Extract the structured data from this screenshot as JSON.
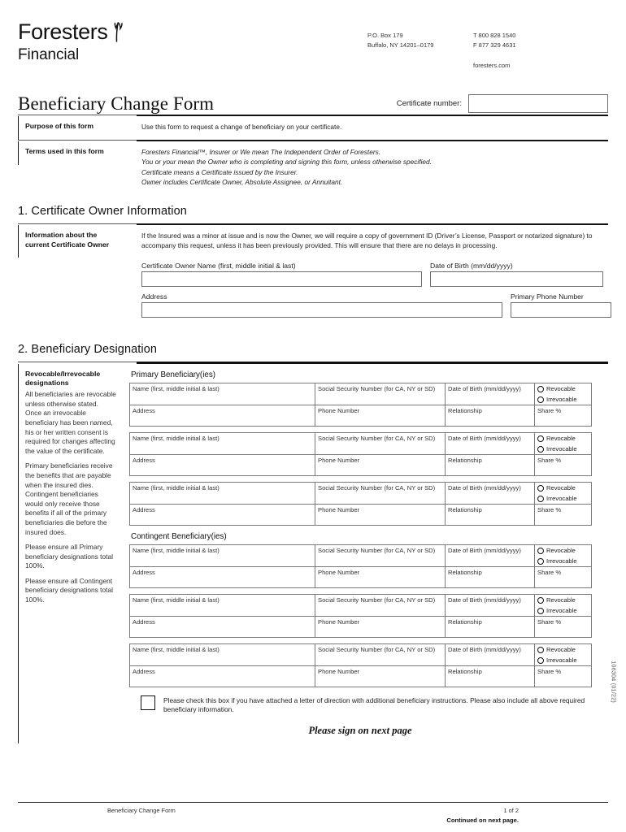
{
  "brand": {
    "name": "Foresters",
    "sub": "Financial",
    "logo_icon": "wheat-sprig-icon"
  },
  "contact": {
    "po_box": "P.O. Box 179",
    "city_state_zip": "Buffalo, NY 14201–0179",
    "phone": "T  800 828 1540",
    "fax": "F  877 329 4631",
    "website": "foresters.com"
  },
  "title": {
    "form_title": "Beneficiary Change Form",
    "certificate_label": "Certificate number:",
    "certificate_value": ""
  },
  "purpose": {
    "label": "Purpose of this form",
    "text": "Use this form to request a change of beneficiary on your certificate."
  },
  "terms": {
    "label": "Terms used in this form",
    "lines": [
      "Foresters Financial™, Insurer or We mean The Independent Order of Foresters.",
      "You or your mean the Owner who is completing and signing this form, unless otherwise specified.",
      "Certificate means a Certificate issued by the Insurer.",
      "Owner includes Certificate Owner, Absolute Assignee, or Annuitant."
    ]
  },
  "section1": {
    "heading": "1. Certificate Owner Information",
    "label": "Information about the current Certificate Owner",
    "text": "If the Insured was a minor at issue and is now the Owner, we will require a copy of government ID (Driver’s License, Passport or notarized signature) to accompany this request, unless it has been previously provided. This will ensure that there are no delays in processing.",
    "fields": {
      "owner_name": "Certificate Owner Name (first, middle initial & last)",
      "dob": "Date of Birth (mm/dd/yyyy)",
      "address": "Address",
      "phone": "Primary Phone Number",
      "owner_name_value": "",
      "dob_value": "",
      "address_value": "",
      "phone_value": ""
    }
  },
  "section2": {
    "heading": "2. Beneficiary Designation",
    "sidebar": {
      "title": "Revocable/Irrevocable designations",
      "paragraphs": [
        "All beneficiaries are revocable unless otherwise stated. Once an irrevocable beneficiary has been named, his or her written consent is required for changes affecting the value of the certificate.",
        "Primary beneficiaries receive the benefits that are payable when the insured dies. Contingent beneficiaries would only receive those benefits if all of the primary beneficiaries die before the insured does.",
        "Please ensure all Primary beneficiary designations total 100%.",
        "Please ensure all Contingent beneficiary designations total 100%."
      ]
    },
    "primary_title": "Primary Beneficiary(ies)",
    "contingent_title": "Contingent Beneficiary(ies)",
    "columns": {
      "name": "Name (first, middle initial & last)",
      "ssn": "Social Security Number (for CA, NY or SD)",
      "dob": "Date of Birth (mm/dd/yyyy)",
      "address": "Address",
      "phone": "Phone Number",
      "relationship": "Relationship",
      "share": "Share %"
    },
    "options": {
      "revocable": "Revocable",
      "irrevocable": "Irrevocable"
    },
    "primary_rows": 3,
    "contingent_rows": 3,
    "checkbox_note": "Please check this box if you have attached a letter of direction with additional beneficiary instructions. Please also include all above required beneficiary information.",
    "checkbox_checked": false,
    "sign_note": "Please sign on next page"
  },
  "margin": {
    "form_code": "106304 (01/22)"
  },
  "footer": {
    "form_name": "Beneficiary Change Form",
    "page": "1 of 2",
    "continued": "Continued on next page."
  }
}
